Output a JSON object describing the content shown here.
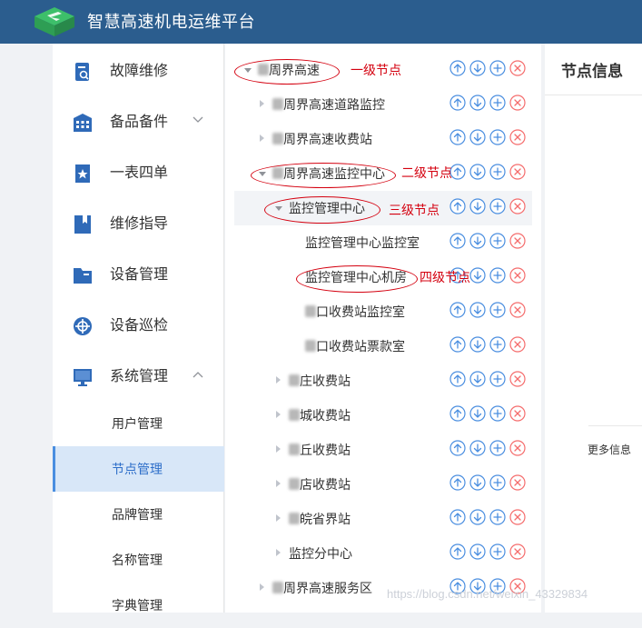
{
  "app": {
    "title": "智慧高速机电运维平台"
  },
  "sidebar": {
    "items": [
      {
        "label": "故障维修",
        "icon": "repair-icon"
      },
      {
        "label": "备品备件",
        "icon": "warehouse-icon",
        "expandable": true,
        "expanded": false
      },
      {
        "label": "一表四单",
        "icon": "star-doc-icon"
      },
      {
        "label": "维修指导",
        "icon": "book-icon"
      },
      {
        "label": "设备管理",
        "icon": "folder-icon"
      },
      {
        "label": "设备巡检",
        "icon": "target-icon"
      },
      {
        "label": "系统管理",
        "icon": "monitor-icon",
        "expandable": true,
        "expanded": true
      }
    ],
    "subitems": [
      {
        "label": "用户管理",
        "active": false
      },
      {
        "label": "节点管理",
        "active": true
      },
      {
        "label": "品牌管理",
        "active": false
      },
      {
        "label": "名称管理",
        "active": false
      },
      {
        "label": "字典管理",
        "active": false
      }
    ]
  },
  "tree": {
    "nodes": [
      {
        "label": "周界高速",
        "level": 1,
        "expanded": true
      },
      {
        "label": "周界高速道路监控",
        "level": 2
      },
      {
        "label": "周界高速收费站",
        "level": 2
      },
      {
        "label": "周界高速监控中心",
        "level": 2,
        "expanded": true
      },
      {
        "label": "监控管理中心",
        "level": 3,
        "expanded": true,
        "highlighted": true
      },
      {
        "label": "监控管理中心监控室",
        "level": 4
      },
      {
        "label": "监控管理中心机房",
        "level": 4
      },
      {
        "label": "口收费站监控室",
        "level": 4
      },
      {
        "label": "口收费站票款室",
        "level": 4
      },
      {
        "label": "庄收费站",
        "level": 3
      },
      {
        "label": "城收费站",
        "level": 3
      },
      {
        "label": "丘收费站",
        "level": 3
      },
      {
        "label": "店收费站",
        "level": 3
      },
      {
        "label": "皖省界站",
        "level": 3
      },
      {
        "label": "监控分中心",
        "level": 3
      },
      {
        "label": "周界高速服务区",
        "level": 2
      }
    ],
    "op_icons": [
      "move-up-icon",
      "move-down-icon",
      "add-icon",
      "delete-icon"
    ]
  },
  "annotations": {
    "level1": "一级节点",
    "level2": "二级节点",
    "level3": "三级节点",
    "level4": "四级节点"
  },
  "detail": {
    "title": "节点信息",
    "more": "更多信息"
  },
  "watermark": "https://blog.csdn.net/weixin_43329834",
  "colors": {
    "header": "#2b5d8e",
    "accent": "#4a8ee0",
    "active_bg": "#d8e7f8",
    "annotation": "#d4000f",
    "op_blue": "#4a8ee0",
    "op_red": "#f56c6c"
  }
}
